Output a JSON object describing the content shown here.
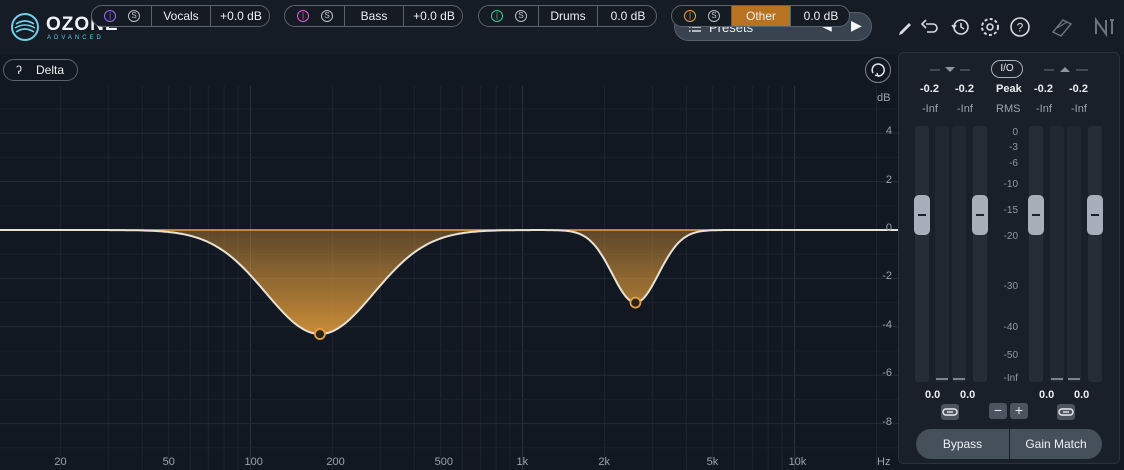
{
  "app": {
    "logo_text": "OZONE",
    "logo_sub": "ADVANCED",
    "presets_label": "Presets",
    "prev_arrow": "◀",
    "next_arrow": "▶"
  },
  "toolbar": {
    "icons": [
      "pencil-icon",
      "undo-icon",
      "history-icon",
      "settings-gear-icon",
      "help-icon",
      "modules-icon",
      "ni-logo-icon"
    ]
  },
  "bands": {
    "delta_label": "Delta",
    "items": [
      {
        "name": "Vocals",
        "gain": "+0.0 dB",
        "color": "#9b6cff",
        "active": false
      },
      {
        "name": "Bass",
        "gain": "+0.0 dB",
        "color": "#e45ad8",
        "active": false
      },
      {
        "name": "Drums",
        "gain": "0.0 dB",
        "color": "#3fc98a",
        "active": false
      },
      {
        "name": "Other",
        "gain": "0.0 dB",
        "color": "#f0a23c",
        "active": true
      }
    ],
    "solo_label": "S"
  },
  "graph": {
    "db_unit": "dB",
    "y_ticks": [
      "4",
      "2",
      "0",
      "-2",
      "-4",
      "-6",
      "-8"
    ],
    "x_ticks": [
      "20",
      "50",
      "100",
      "200",
      "500",
      "1k",
      "2k",
      "5k",
      "10k"
    ],
    "hz_unit": "Hz",
    "curve_color": "#e8e2d6",
    "fill_color": "#e8a03c",
    "nodes": [
      {
        "freq_hz": 180,
        "gain_db": -4.3
      },
      {
        "freq_hz": 2600,
        "gain_db": -3.0
      }
    ]
  },
  "meters": {
    "input_values": [
      "-0.2",
      "-0.2"
    ],
    "input_rms": [
      "-Inf",
      "-Inf"
    ],
    "output_values": [
      "-0.2",
      "-0.2"
    ],
    "output_rms": [
      "-Inf",
      "-Inf"
    ],
    "io_label": "I/O",
    "peak_label": "Peak",
    "rms_label": "RMS",
    "scale": [
      "0",
      "-3",
      "-6",
      "-10",
      "-15",
      "-20",
      "-30",
      "-40",
      "-50",
      "-Inf"
    ],
    "input_gain": [
      "0.0",
      "0.0"
    ],
    "output_gain": [
      "0.0",
      "0.0"
    ],
    "minus": "−",
    "plus": "+",
    "bypass_label": "Bypass",
    "gain_match_label": "Gain Match"
  }
}
